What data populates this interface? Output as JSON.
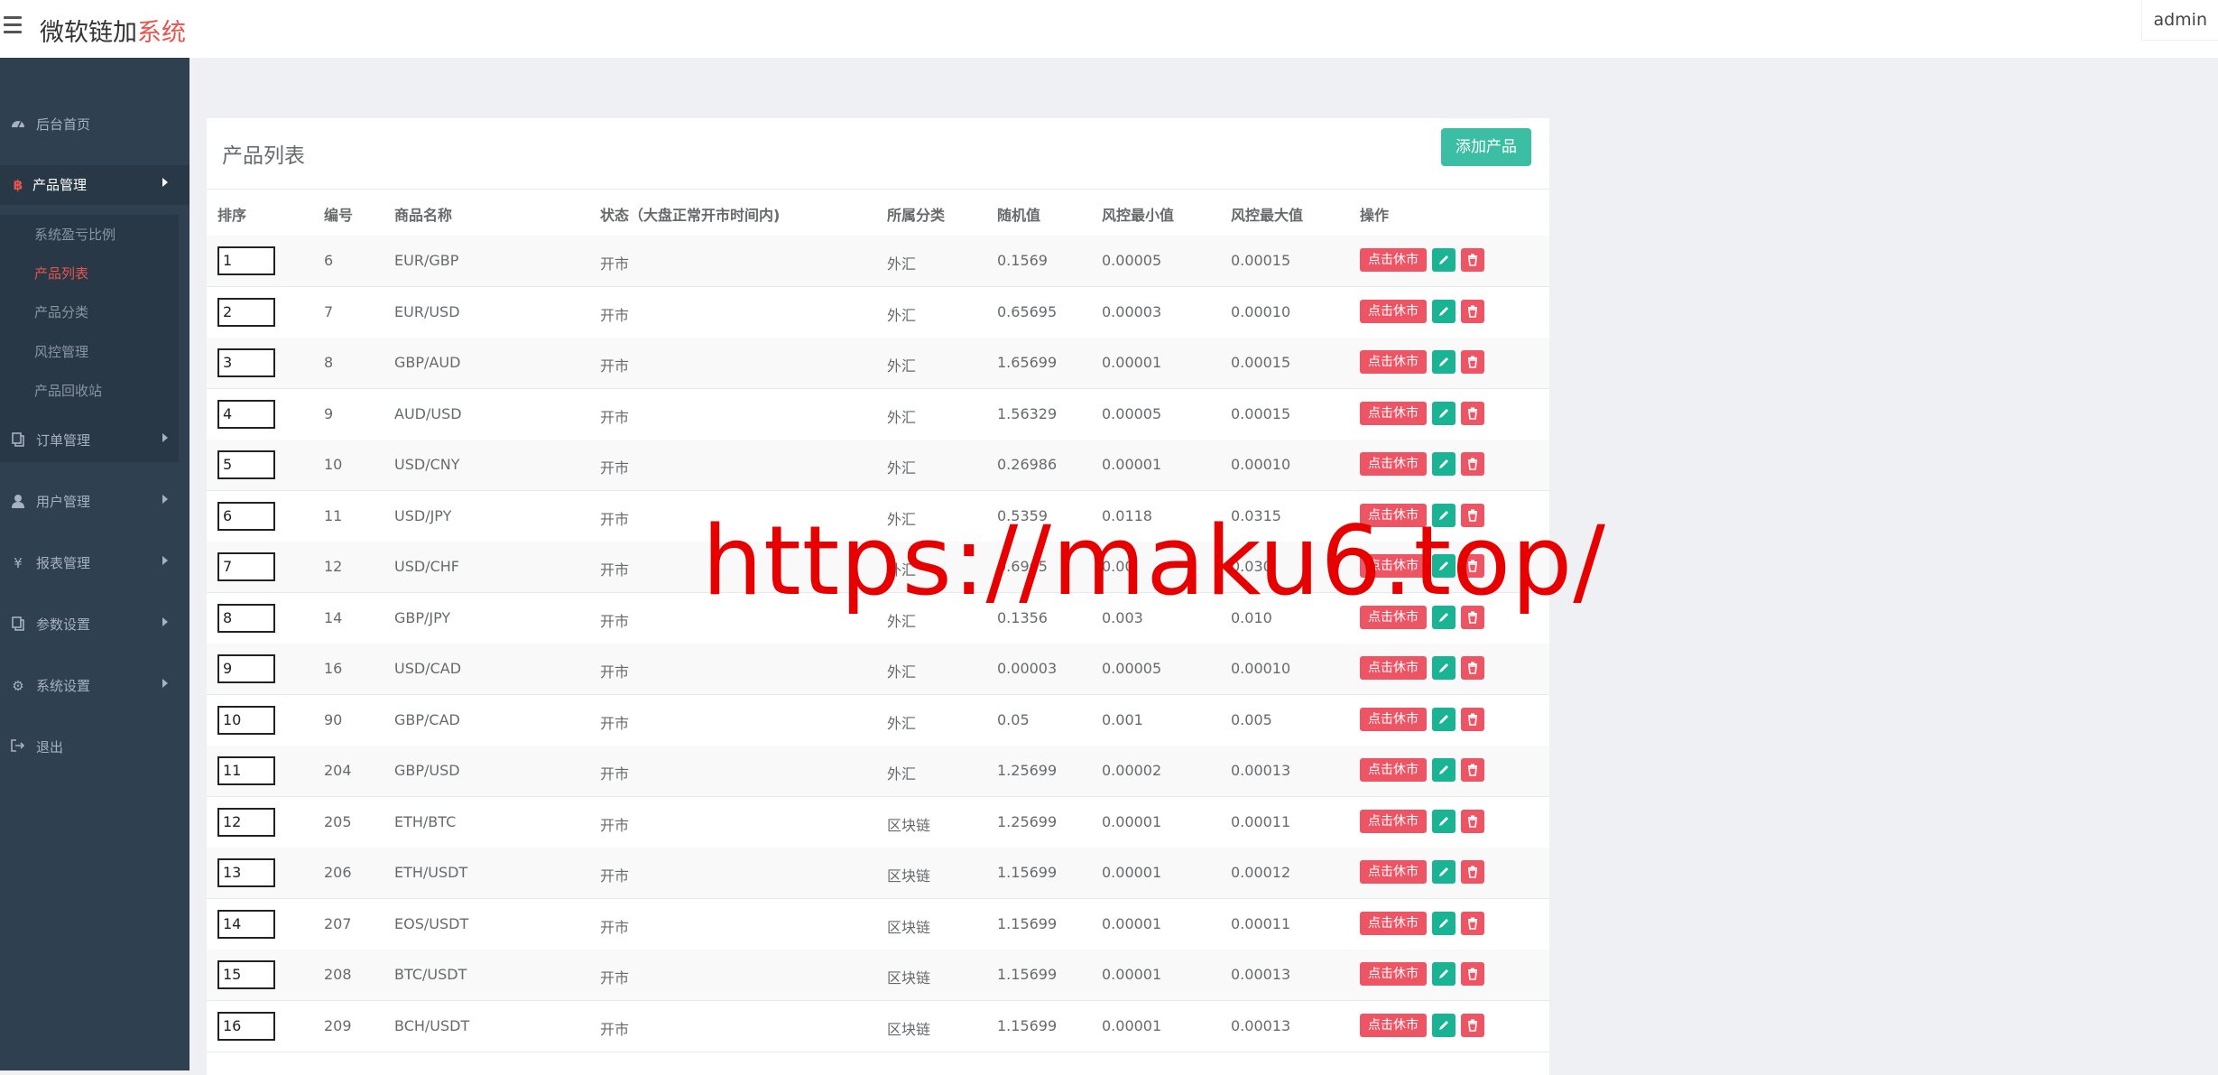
{
  "header": {
    "logo_main": "微软链加",
    "logo_accent": "系统",
    "user": "admin"
  },
  "sidebar": {
    "items": [
      {
        "label": "后台首页",
        "icon": "dashboard-icon"
      },
      {
        "label": "产品管理",
        "icon": "bitcoin-icon"
      },
      {
        "label": "订单管理",
        "icon": "copy-icon"
      },
      {
        "label": "用户管理",
        "icon": "user-icon"
      },
      {
        "label": "报表管理",
        "icon": "yen-icon"
      },
      {
        "label": "参数设置",
        "icon": "file-icon"
      },
      {
        "label": "系统设置",
        "icon": "cogs-icon"
      },
      {
        "label": "退出",
        "icon": "sign-out-icon"
      }
    ],
    "submenu": [
      {
        "label": "系统盈亏比例"
      },
      {
        "label": "产品列表"
      },
      {
        "label": "产品分类"
      },
      {
        "label": "风控管理"
      },
      {
        "label": "产品回收站"
      }
    ]
  },
  "panel": {
    "title": "产品列表",
    "add_button": "添加产品"
  },
  "table": {
    "headers": {
      "sort": "排序",
      "id": "编号",
      "name": "商品名称",
      "status": "状态（大盘正常开市时间内)",
      "category": "所属分类",
      "random": "随机值",
      "risk_min": "风控最小值",
      "risk_max": "风控最大值",
      "actions": "操作"
    },
    "rows": [
      {
        "sort": "1",
        "id": "6",
        "name": "EUR/GBP",
        "status": "开市",
        "category": "外汇",
        "random": "0.1569",
        "min": "0.00005",
        "max": "0.00015"
      },
      {
        "sort": "2",
        "id": "7",
        "name": "EUR/USD",
        "status": "开市",
        "category": "外汇",
        "random": "0.65695",
        "min": "0.00003",
        "max": "0.00010"
      },
      {
        "sort": "3",
        "id": "8",
        "name": "GBP/AUD",
        "status": "开市",
        "category": "外汇",
        "random": "1.65699",
        "min": "0.00001",
        "max": "0.00015"
      },
      {
        "sort": "4",
        "id": "9",
        "name": "AUD/USD",
        "status": "开市",
        "category": "外汇",
        "random": "1.56329",
        "min": "0.00005",
        "max": "0.00015"
      },
      {
        "sort": "5",
        "id": "10",
        "name": "USD/CNY",
        "status": "开市",
        "category": "外汇",
        "random": "0.26986",
        "min": "0.00001",
        "max": "0.00010"
      },
      {
        "sort": "6",
        "id": "11",
        "name": "USD/JPY",
        "status": "开市",
        "category": "外汇",
        "random": "0.5359",
        "min": "0.0118",
        "max": "0.0315"
      },
      {
        "sort": "7",
        "id": "12",
        "name": "USD/CHF",
        "status": "开市",
        "category": "外汇",
        "random": "0.6965",
        "min": "0.00",
        "max": "0.030"
      },
      {
        "sort": "8",
        "id": "14",
        "name": "GBP/JPY",
        "status": "开市",
        "category": "外汇",
        "random": "0.1356",
        "min": "0.003",
        "max": "0.010"
      },
      {
        "sort": "9",
        "id": "16",
        "name": "USD/CAD",
        "status": "开市",
        "category": "外汇",
        "random": "0.00003",
        "min": "0.00005",
        "max": "0.00010"
      },
      {
        "sort": "10",
        "id": "90",
        "name": "GBP/CAD",
        "status": "开市",
        "category": "外汇",
        "random": "0.05",
        "min": "0.001",
        "max": "0.005"
      },
      {
        "sort": "11",
        "id": "204",
        "name": "GBP/USD",
        "status": "开市",
        "category": "外汇",
        "random": "1.25699",
        "min": "0.00002",
        "max": "0.00013"
      },
      {
        "sort": "12",
        "id": "205",
        "name": "ETH/BTC",
        "status": "开市",
        "category": "区块链",
        "random": "1.25699",
        "min": "0.00001",
        "max": "0.00011"
      },
      {
        "sort": "13",
        "id": "206",
        "name": "ETH/USDT",
        "status": "开市",
        "category": "区块链",
        "random": "1.15699",
        "min": "0.00001",
        "max": "0.00012"
      },
      {
        "sort": "14",
        "id": "207",
        "name": "EOS/USDT",
        "status": "开市",
        "category": "区块链",
        "random": "1.15699",
        "min": "0.00001",
        "max": "0.00011"
      },
      {
        "sort": "15",
        "id": "208",
        "name": "BTC/USDT",
        "status": "开市",
        "category": "区块链",
        "random": "1.15699",
        "min": "0.00001",
        "max": "0.00013"
      },
      {
        "sort": "16",
        "id": "209",
        "name": "BCH/USDT",
        "status": "开市",
        "category": "区块链",
        "random": "1.15699",
        "min": "0.00001",
        "max": "0.00013"
      }
    ],
    "pause_button": "点击休市"
  },
  "watermark": "https://maku6.top/",
  "colors": {
    "sidebar_bg": "#2f4050",
    "primary": "#1ab394",
    "danger": "#ed5565",
    "accent": "#e8554e",
    "watermark": "#e60000"
  }
}
